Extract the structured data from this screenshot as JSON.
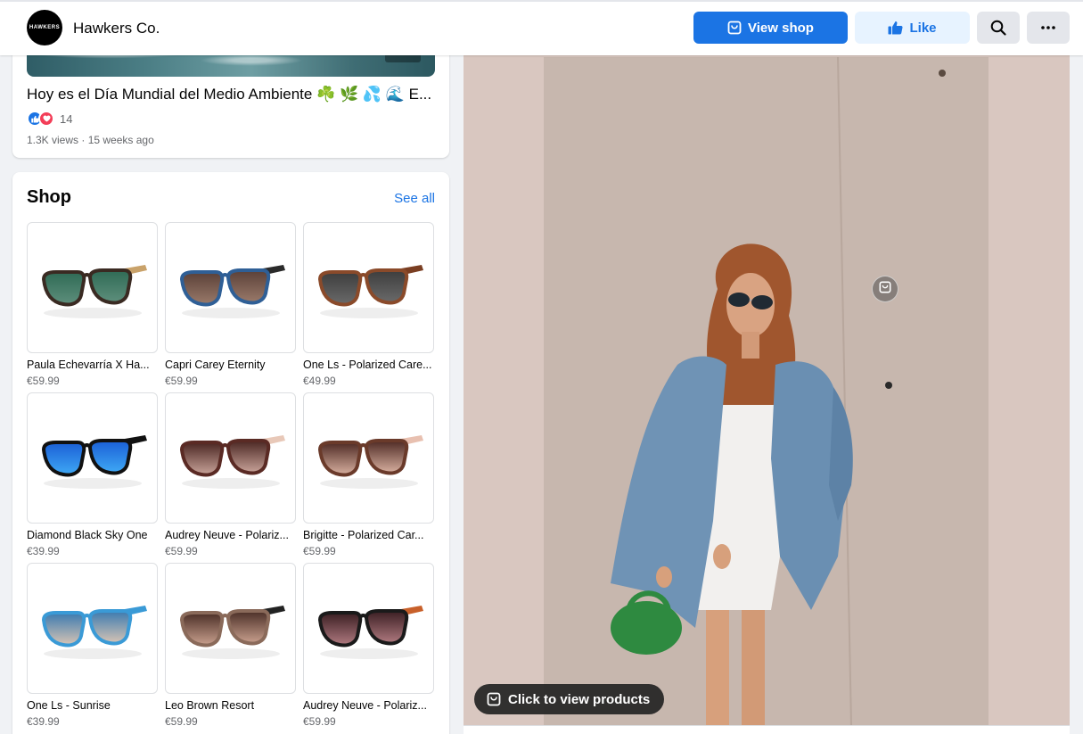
{
  "header": {
    "logo_text": "HAWKERS",
    "page_name": "Hawkers Co.",
    "view_shop_label": "View shop",
    "like_label": "Like"
  },
  "video_post": {
    "title": "Hoy es el Día Mundial del Medio Ambiente ☘️ 🌿 💦 🌊 E...",
    "reaction_count": "14",
    "meta": "1.3K views · 15 weeks ago"
  },
  "shop": {
    "title": "Shop",
    "see_all_label": "See all",
    "products": [
      {
        "name": "Paula Echevarría X Ha...",
        "price": "€59.99",
        "frame": "#3a2a22",
        "lens": "#2f6a55",
        "lens2": "#5e8f7c",
        "temple": "#c9a26a"
      },
      {
        "name": "Capri Carey Eternity",
        "price": "€59.99",
        "frame": "#2f5f96",
        "lens": "#5a4038",
        "lens2": "#9a7a6a",
        "temple": "#2a2a2a"
      },
      {
        "name": "One Ls - Polarized Care...",
        "price": "€49.99",
        "frame": "#8a4a2a",
        "lens": "#3d3d3d",
        "lens2": "#6a6a6a",
        "temple": "#7a3e22"
      },
      {
        "name": "Diamond Black Sky One",
        "price": "€39.99",
        "frame": "#111111",
        "lens": "#1a5fd6",
        "lens2": "#3fa9f5",
        "temple": "#111111"
      },
      {
        "name": "Audrey Neuve - Polariz...",
        "price": "€59.99",
        "frame": "#5a2a24",
        "lens": "#4a2622",
        "lens2": "#c9a49a",
        "temple": "#e8c8b8"
      },
      {
        "name": "Brigitte - Polarized Car...",
        "price": "€59.99",
        "frame": "#6a3a2a",
        "lens": "#4e2a24",
        "lens2": "#d8b0a0",
        "temple": "#e8c0b0"
      },
      {
        "name": "One Ls - Sunrise",
        "price": "€39.99",
        "frame": "#3a9ad6",
        "lens": "#3a7ab0",
        "lens2": "#d8c4b4",
        "temple": "#3a9ad6"
      },
      {
        "name": "Leo Brown Resort",
        "price": "€59.99",
        "frame": "#8a6a5a",
        "lens": "#4a2e26",
        "lens2": "#c9a08e",
        "temple": "#222222"
      },
      {
        "name": "Audrey Neuve - Polariz...",
        "price": "€59.99",
        "frame": "#1a1a1a",
        "lens": "#3a1e22",
        "lens2": "#b07a80",
        "temple": "#c8602a"
      }
    ]
  },
  "viewer": {
    "view_products_label": "Click to view products"
  },
  "colors": {
    "accent": "#1b74e4",
    "like_bg": "#e7f3ff",
    "page_bg": "#f0f2f5"
  }
}
